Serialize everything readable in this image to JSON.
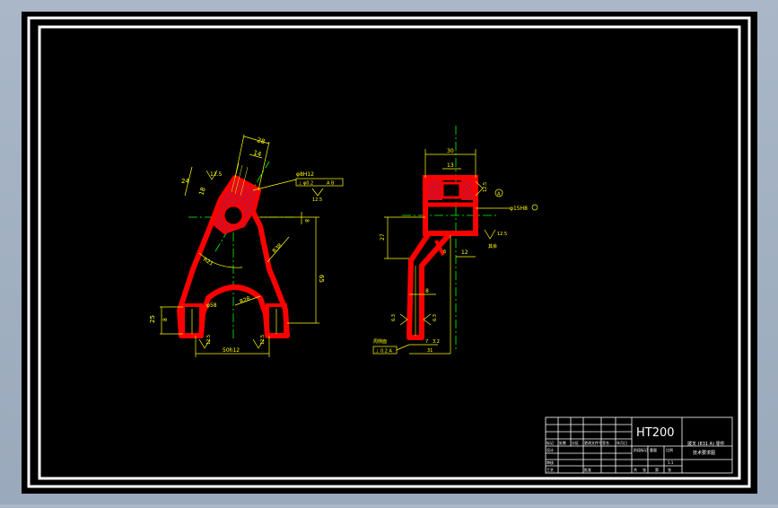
{
  "colors": {
    "background": "#000000",
    "frame": "#ffffff",
    "part": "#ff0000",
    "dimension": "#ffff00",
    "centerline": "#00ff00",
    "hatch": "#4040a0"
  },
  "front_view": {
    "dims": {
      "d28": "28",
      "d14": "14",
      "d24": "24",
      "d12_5_top": "12.5",
      "d18": "18",
      "d8": "8",
      "r38": "R38",
      "r21": "R21",
      "d65": "65",
      "r28": "R28",
      "d8_left": "8",
      "d25": "25",
      "r38b": "R38",
      "phi58": "φ58",
      "r12_5_l": "12.5",
      "r12_5_r": "12.5",
      "d50h12": "50h12",
      "tol_hole": "φ8H12",
      "tol_box_1": "⊥ φ0.2",
      "tol_box_2": "A B",
      "ra_top": "12.5"
    }
  },
  "side_view": {
    "dims": {
      "d30": "30",
      "d13": "13",
      "d12_5": "12.5",
      "d15h8": "φ15H8",
      "datum_a": "A",
      "d27": "27",
      "d12_5b": "12.5",
      "d12": "12",
      "d6": "6",
      "d12_side": "12",
      "surface_note": "其余",
      "d8": "8",
      "d6_3_l": "6.3",
      "d6_3_r": "6.3",
      "d7_2": "7",
      "d31": "31",
      "d3_2": "3.2",
      "note_box": "周侧面",
      "box_value": "⊥ 0.2 A"
    }
  },
  "title_block": {
    "material": "HT200",
    "title_line1": "拨叉 (831 A) 零件",
    "title_line2": "技术要求图",
    "cell_labels": [
      "标记",
      "处数",
      "分区",
      "更改文件号",
      "签名",
      "年月日"
    ],
    "row_labels": [
      "设计",
      "审核",
      "工艺"
    ],
    "cell_stage": "阶段标记",
    "cell_weight": "重量",
    "cell_scale": "比例",
    "scale_value": "1:1",
    "sheet_info": [
      "共",
      "张",
      "第",
      "张"
    ],
    "approve": "批准"
  }
}
